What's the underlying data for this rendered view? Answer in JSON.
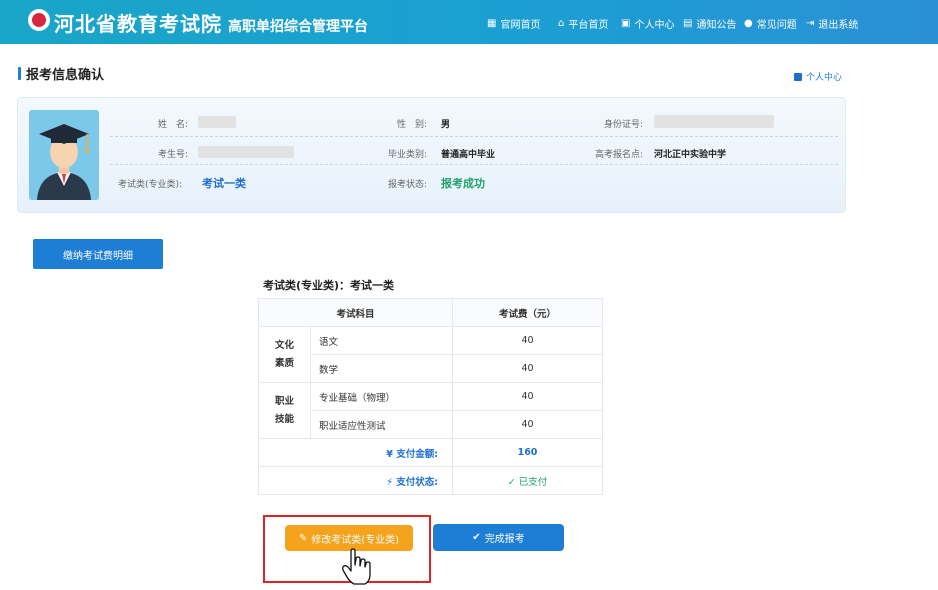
{
  "header": {
    "title": "河北省教育考试院",
    "subtitle": "高职单招综合管理平台",
    "nav": [
      {
        "icon": "dashboard-icon",
        "label": "官网首页"
      },
      {
        "icon": "home-icon",
        "label": "平台首页"
      },
      {
        "icon": "user-card-icon",
        "label": "个人中心"
      },
      {
        "icon": "notice-icon",
        "label": "通知公告"
      },
      {
        "icon": "chat-icon",
        "label": "常见问题"
      },
      {
        "icon": "logout-icon",
        "label": "退出系统"
      }
    ]
  },
  "section": {
    "title": "报考信息确认",
    "top_link": "个人中心"
  },
  "profile": {
    "name_label": "姓　名:",
    "gender_label": "性　别:",
    "gender_value": "男",
    "id_label": "身份证号:",
    "exam_no_label": "考生号:",
    "grad_label": "毕业类别:",
    "grad_value": "普通高中毕业",
    "site_label": "高考报名点:",
    "site_value": "河北正中实验中学",
    "category_label": "考试类(专业类):",
    "category_value": "考试一类",
    "status_label": "报考状态:",
    "status_value": "报考成功"
  },
  "buttons": {
    "pay_detail": "缴纳考试费明细",
    "edit": "修改考试类(专业类)",
    "done": "完成报考"
  },
  "fees": {
    "title": "考试类(专业类)：考试一类",
    "col_subject": "考试科目",
    "col_fee": "考试费（元）",
    "groups": [
      {
        "name_line1": "文化",
        "name_line2": "素质",
        "rows": [
          {
            "subject": "语文",
            "fee": "40"
          },
          {
            "subject": "数学",
            "fee": "40"
          }
        ]
      },
      {
        "name_line1": "职业",
        "name_line2": "技能",
        "rows": [
          {
            "subject": "专业基础（物理）",
            "fee": "40"
          },
          {
            "subject": "职业适应性测试",
            "fee": "40"
          }
        ]
      }
    ],
    "total_label": "¥ 支付金额:",
    "total_value": "160",
    "status_label": "⚡ 支付状态:",
    "status_value": "✓ 已支付"
  },
  "colors": {
    "header_bg": "#1ba2cf",
    "primary": "#1e7ed6",
    "warning": "#f5a21d",
    "success": "#20a26a",
    "highlight": "#e02323"
  }
}
